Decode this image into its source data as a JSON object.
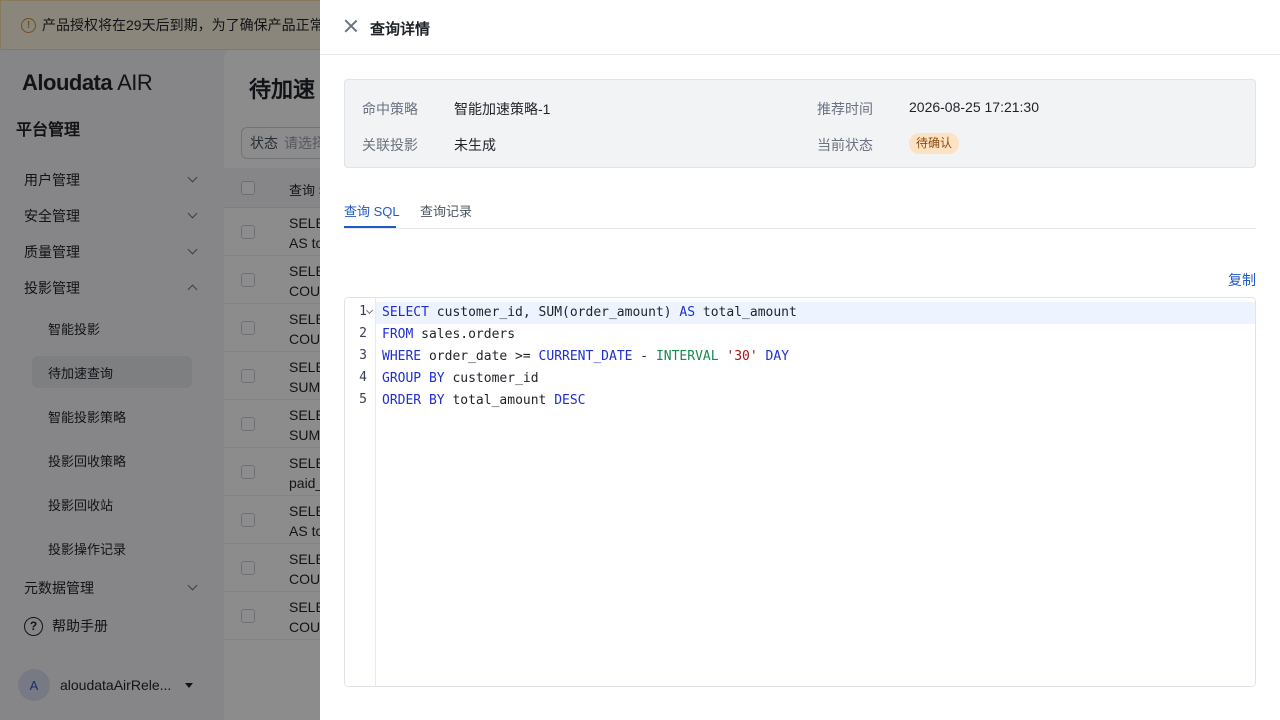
{
  "banner": {
    "text": "产品授权将在29天后到期，为了确保产品正常"
  },
  "brand": {
    "name": "Aloudata",
    "suffix": "AIR"
  },
  "sidebar": {
    "title": "平台管理",
    "groups": [
      {
        "label": "用户管理"
      },
      {
        "label": "安全管理"
      },
      {
        "label": "质量管理"
      },
      {
        "label": "投影管理"
      },
      {
        "label": "元数据管理"
      }
    ],
    "sub_items": [
      {
        "label": "智能投影"
      },
      {
        "label": "待加速查询"
      },
      {
        "label": "智能投影策略"
      },
      {
        "label": "投影回收策略"
      },
      {
        "label": "投影回收站"
      },
      {
        "label": "投影操作记录"
      }
    ],
    "help": "帮助手册",
    "user": {
      "avatar": "A",
      "name": "aloudataAirRele..."
    }
  },
  "main": {
    "title": "待加速",
    "filter_label": "状态",
    "filter_placeholder": "请选择",
    "col_header": "查询 S",
    "rows": [
      [
        "SELE",
        "AS to"
      ],
      [
        "SELE",
        "COU"
      ],
      [
        "SELE",
        "COU"
      ],
      [
        "SELE",
        "SUM"
      ],
      [
        "SELE",
        "SUM"
      ],
      [
        "SELE",
        "paid_"
      ],
      [
        "SELE",
        "AS to"
      ],
      [
        "SELE",
        "COU"
      ],
      [
        "SELE",
        "COU"
      ]
    ]
  },
  "drawer": {
    "title": "查询详情",
    "info": {
      "strategy_label": "命中策略",
      "strategy_value": "智能加速策略-1",
      "time_label": "推荐时间",
      "time_value": "2026-08-25 17:21:30",
      "projection_label": "关联投影",
      "projection_value": "未生成",
      "status_label": "当前状态",
      "status_value": "待确认"
    },
    "tabs": [
      {
        "label": "查询 SQL"
      },
      {
        "label": "查询记录"
      }
    ],
    "copy_label": "复制",
    "sql_lines": [
      [
        {
          "t": "SELECT",
          "c": "kw"
        },
        {
          "t": " customer_id, SUM(order_amount) ",
          "c": "fn"
        },
        {
          "t": "AS",
          "c": "kw"
        },
        {
          "t": " total_amount",
          "c": "fn"
        }
      ],
      [
        {
          "t": "FROM",
          "c": "kw"
        },
        {
          "t": " sales.orders",
          "c": "fn"
        }
      ],
      [
        {
          "t": "WHERE",
          "c": "kw"
        },
        {
          "t": " order_date >= ",
          "c": "fn"
        },
        {
          "t": "CURRENT_DATE",
          "c": "kw"
        },
        {
          "t": " - ",
          "c": "fn"
        },
        {
          "t": "INTERVAL",
          "c": "ty"
        },
        {
          "t": " ",
          "c": "fn"
        },
        {
          "t": "'30'",
          "c": "str"
        },
        {
          "t": " ",
          "c": "fn"
        },
        {
          "t": "DAY",
          "c": "kw"
        }
      ],
      [
        {
          "t": "GROUP BY",
          "c": "kw"
        },
        {
          "t": " customer_id",
          "c": "fn"
        }
      ],
      [
        {
          "t": "ORDER BY",
          "c": "kw"
        },
        {
          "t": " total_amount ",
          "c": "fn"
        },
        {
          "t": "DESC",
          "c": "kw"
        }
      ]
    ]
  },
  "colors": {
    "accent": "#2259c9",
    "badge_bg": "#fde3c4",
    "overlay": "rgba(0,0,0,0.45)"
  }
}
